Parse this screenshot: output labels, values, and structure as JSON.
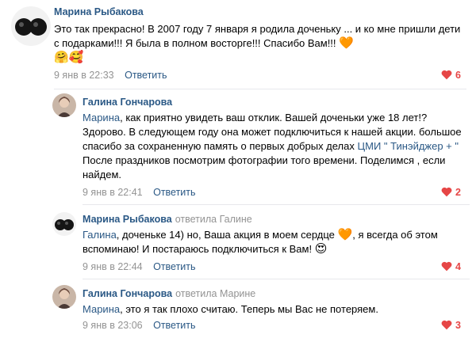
{
  "comments": [
    {
      "author": "Марина Рыбакова",
      "text": "Это так прекрасно! В 2007 году 7 января я родила доченьку ... и ко мне пришли дети с подарками!!! Я была в полном восторге!!! Спасибо Вам!!! ",
      "emoji_end": "🧡",
      "emoji_line2": "🤗🥰",
      "date": "9 янв в 22:33",
      "reply_label": "Ответить",
      "likes": "6"
    },
    {
      "author": "Галина Гончарова",
      "mention": "Марина",
      "text": ", как приятно увидеть ваш отклик. Вашей доченьки уже 18 лет!? Здорово. В следующем году она может подключиться к нашей акции. большое спасибо за сохраненную память о первых добрых делах ",
      "link": "ЦМИ \" Тинэйджер + \"",
      "text_after": " После праздников посмотрим фотографии того времени. Поделимся , если найдем.",
      "date": "9 янв в 22:41",
      "reply_label": "Ответить",
      "likes": "2"
    },
    {
      "author": "Марина Рыбакова",
      "replied_to": "ответила Галине",
      "mention": "Галина",
      "text": ", доченьке 14) но, Ваша акция в моем сердце ",
      "emoji_mid": "🧡",
      "text_after": ", я всегда об этом вспоминаю! И постараюсь подключиться к Вам! ",
      "emoji_end": "😍",
      "date": "9 янв в 22:44",
      "reply_label": "Ответить",
      "likes": "4"
    },
    {
      "author": "Галина Гончарова",
      "replied_to": "ответила Марине",
      "mention": "Марина",
      "text": ", это я так плохо считаю. Теперь мы Вас не потеряем.",
      "date": "9 янв в 23:06",
      "reply_label": "Ответить",
      "likes": "3"
    }
  ],
  "colors": {
    "link": "#2a5885",
    "muted": "#939393",
    "like": "#e64646"
  },
  "icons": {
    "like": "heart-icon"
  }
}
